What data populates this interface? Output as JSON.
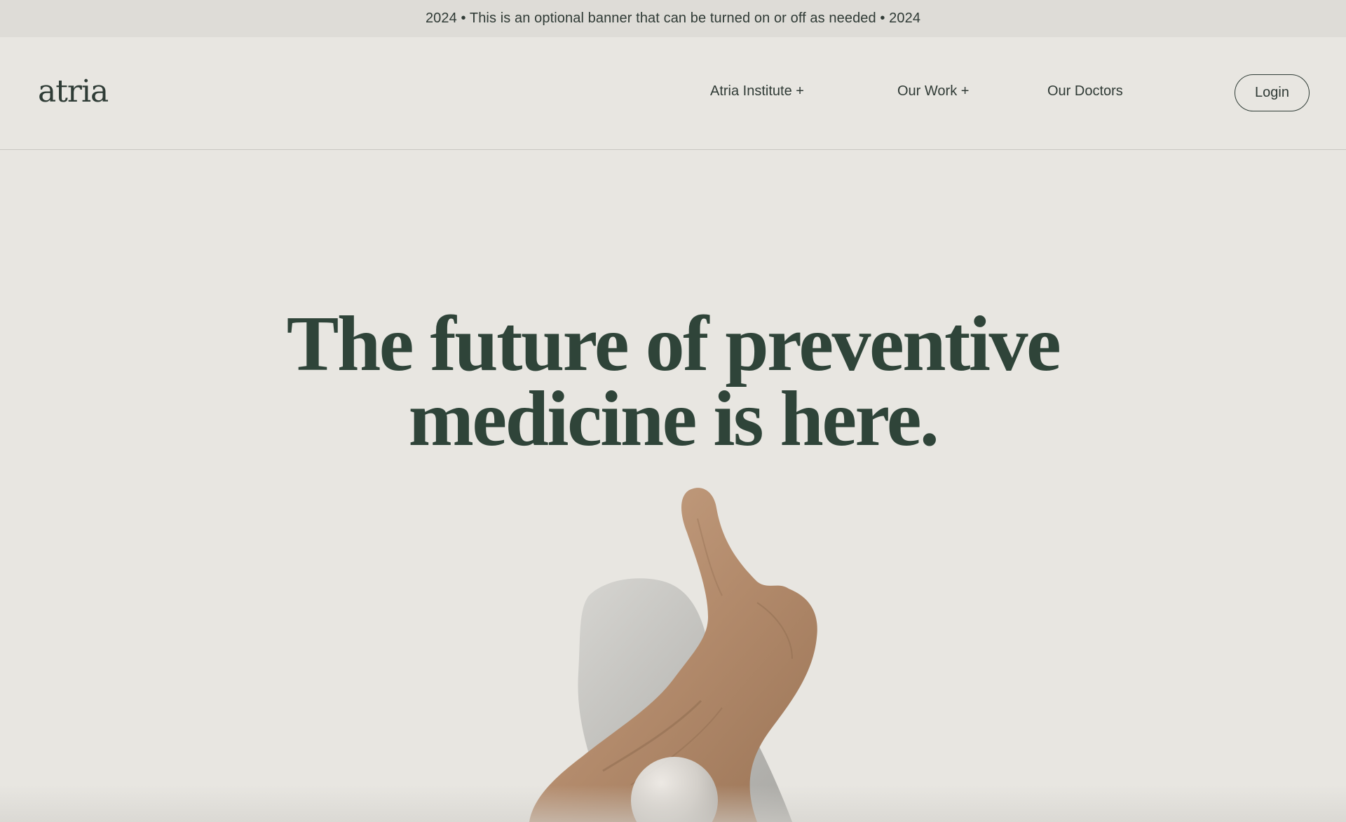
{
  "banner": {
    "text": "2024 • This is an optional banner that can be turned on or off as needed • 2024"
  },
  "header": {
    "logo": "atria",
    "nav": [
      {
        "label": "Atria Institute +"
      },
      {
        "label": "Our Work +"
      },
      {
        "label": "Our Doctors"
      }
    ],
    "login_label": "Login"
  },
  "hero": {
    "title_line_1": "The future of preventive",
    "title_line_2": "medicine is here."
  },
  "colors": {
    "background": "#e8e6e1",
    "banner_bg": "#dedcd7",
    "heading": "#2f4439",
    "text": "#2f3a35"
  },
  "icons": {
    "hero_image": "driftwood-stone-sculpture-image"
  }
}
